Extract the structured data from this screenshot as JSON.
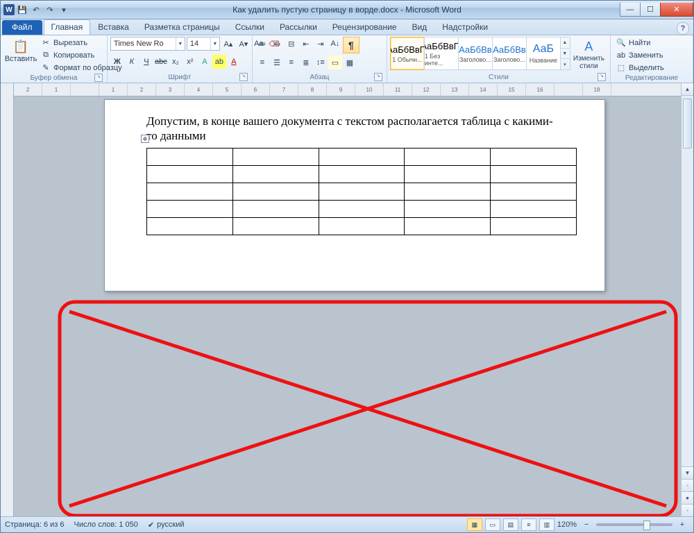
{
  "title": "Как удалить пустую страницу в ворде.docx - Microsoft Word",
  "qat": {
    "save": "💾",
    "undo": "↶",
    "redo": "↷"
  },
  "tabs": {
    "file": "Файл",
    "items": [
      "Главная",
      "Вставка",
      "Разметка страницы",
      "Ссылки",
      "Рассылки",
      "Рецензирование",
      "Вид",
      "Надстройки"
    ],
    "active": 0
  },
  "ribbon": {
    "clipboard": {
      "paste": "Вставить",
      "cut": "Вырезать",
      "copy": "Копировать",
      "format_painter": "Формат по образцу",
      "label": "Буфер обмена"
    },
    "font": {
      "name": "Times New Ro",
      "size": "14",
      "label": "Шрифт"
    },
    "paragraph": {
      "label": "Абзац",
      "pilcrow": "¶"
    },
    "styles": {
      "label": "Стили",
      "change": "Изменить стили",
      "items": [
        {
          "sample": "АаБбВвГг",
          "name": "1 Обычн...",
          "sel": true,
          "color": "#000"
        },
        {
          "sample": "АаБбВвГг",
          "name": "1 Без инте...",
          "color": "#000"
        },
        {
          "sample": "АаБбВв",
          "name": "Заголово...",
          "color": "#1f6fd1"
        },
        {
          "sample": "АаБбВв",
          "name": "Заголово...",
          "color": "#1f6fd1"
        },
        {
          "sample": "АаБ",
          "name": "Название",
          "color": "#1f6fd1"
        }
      ]
    },
    "editing": {
      "find": "Найти",
      "replace": "Заменить",
      "select": "Выделить",
      "label": "Редактирование"
    }
  },
  "document": {
    "text": "Допустим, в конце вашего документа с текстом располагается таблица с какими-то данными",
    "table": {
      "rows": 5,
      "cols": 5
    }
  },
  "status": {
    "page": "Страница: 6 из 6",
    "words": "Число слов: 1 050",
    "lang": "русский",
    "zoom": "120%"
  },
  "ruler": {
    "marks": [
      "2",
      "1",
      "",
      "1",
      "2",
      "3",
      "4",
      "5",
      "6",
      "7",
      "8",
      "9",
      "10",
      "11",
      "12",
      "13",
      "14",
      "15",
      "16",
      "",
      "18"
    ]
  }
}
